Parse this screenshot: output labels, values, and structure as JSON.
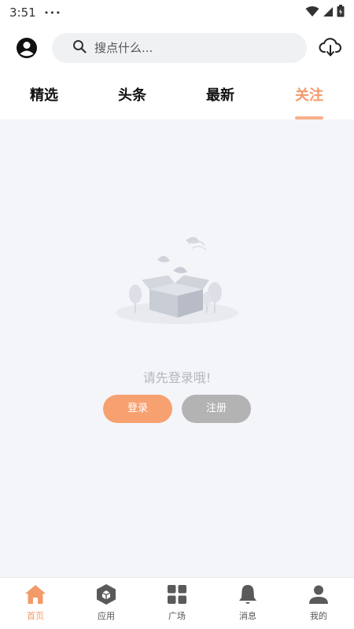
{
  "status_bar": {
    "time": "3:51",
    "dots": "•••"
  },
  "header": {
    "search_placeholder": "搜点什么..."
  },
  "tabs": [
    {
      "label": "精选"
    },
    {
      "label": "头条"
    },
    {
      "label": "最新"
    },
    {
      "label": "关注"
    }
  ],
  "active_tab": "关注",
  "empty_state": {
    "message": "请先登录哦!"
  },
  "buttons": {
    "login": "登录",
    "register": "注册"
  },
  "bottom_nav": [
    {
      "label": "首页",
      "icon": "home-icon"
    },
    {
      "label": "应用",
      "icon": "cube-icon"
    },
    {
      "label": "广场",
      "icon": "grid-icon"
    },
    {
      "label": "消息",
      "icon": "bell-icon"
    },
    {
      "label": "我的",
      "icon": "person-icon"
    }
  ],
  "colors": {
    "accent": "#f39a6b",
    "login_button": "#f7a170",
    "register_button": "#b3b3b3",
    "content_bg": "#f4f5f9"
  }
}
